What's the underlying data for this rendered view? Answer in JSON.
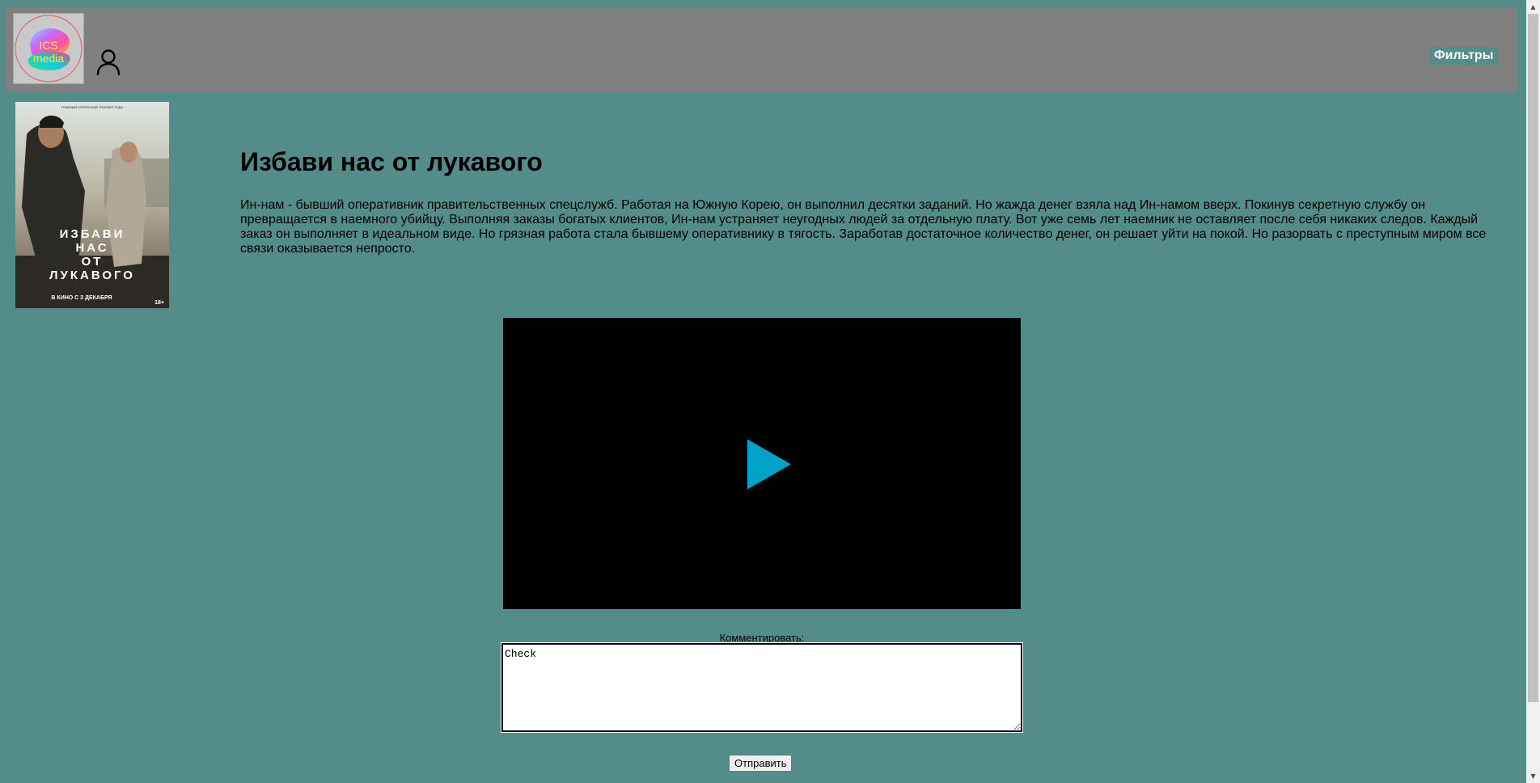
{
  "header": {
    "logo_text_line1": "ICS",
    "logo_text_line2": "media",
    "filters_label": "Фильтры"
  },
  "icons": {
    "user": "user-icon",
    "play": "play-icon"
  },
  "movie": {
    "title": "Избави нас от лукавого",
    "description": "Ин-нам - бывший оперативник правительственных спецслужб. Работая на Южную Корею, он выполнил десятки заданий. Но жажда денег взяла над Ин-намом вверх. Покинув секретную службу он превращается в наемного убийцу. Выполняя заказы богатых клиентов, Ин-нам устраняет неугодных людей за отдельную плату. Вот уже семь лет наемник не оставляет после себя никаких следов. Каждый заказ он выполняет в идеальном виде. Но грязная работа стала бывшему оперативнику в тягость. Заработав достаточное количество денег, он решает уйти на покой. Но разорвать с преступным миром все связи оказывается непросто.",
    "poster": {
      "top_text": "ГЛАВНЫЙ КОРЕЙСКИЙ ТРИЛЛЕР ГОДА",
      "title_lines": [
        "ИЗБАВИ",
        "НАС",
        "ОТ",
        "ЛУКАВОГО"
      ],
      "release": "В КИНО С 3 ДЕКАБРЯ",
      "age": "18+"
    }
  },
  "comment": {
    "label": "Комментировать:",
    "value": "Check",
    "submit_label": "Отправить"
  },
  "colors": {
    "page_background": "#548c89",
    "header_background": "#808080",
    "play_button": "#00a2c7"
  }
}
